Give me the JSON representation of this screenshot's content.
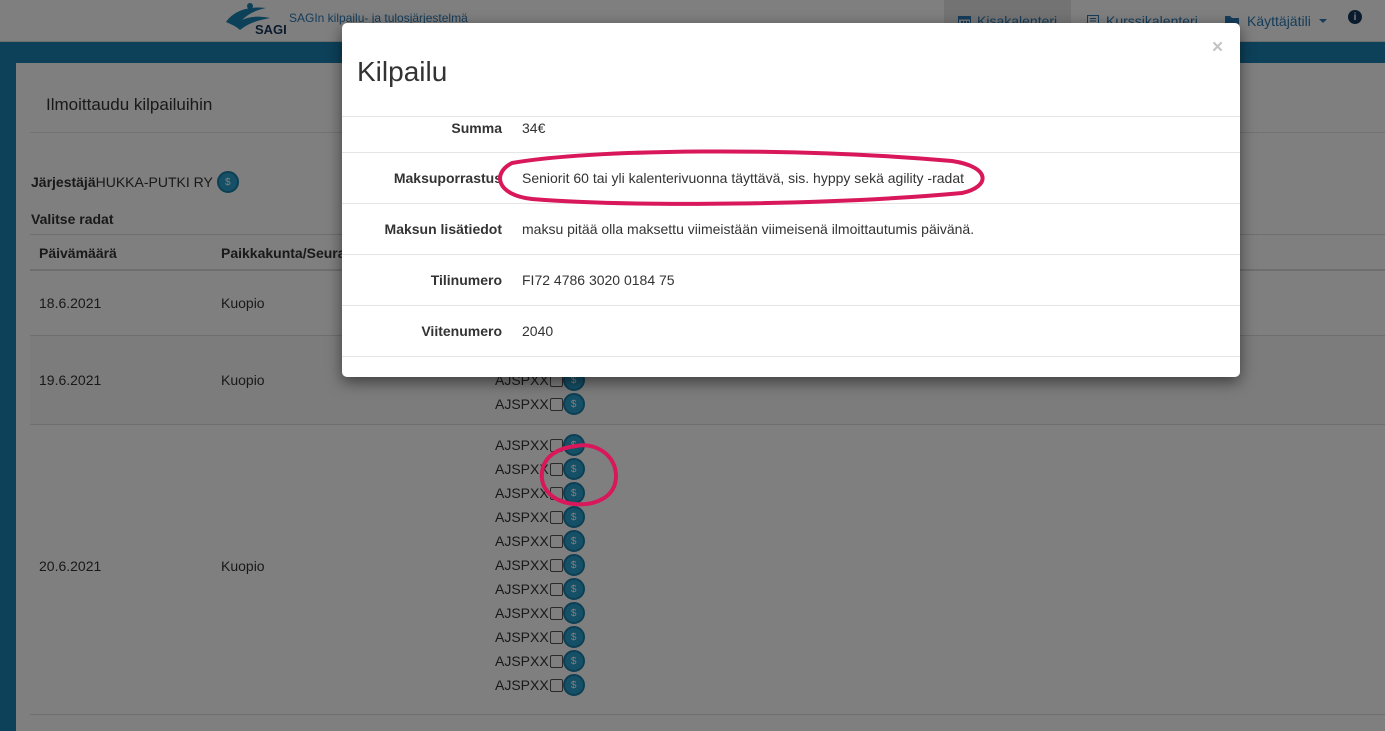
{
  "navbar": {
    "logo_text": "SAGI",
    "brand": "SAGIn kilpailu- ja tulosjärjestelmä",
    "items": [
      {
        "label": "Kisakalenteri",
        "icon": "calendar-icon",
        "active": true
      },
      {
        "label": "Kurssikalenteri",
        "icon": "list-icon",
        "active": false
      },
      {
        "label": "Käyttäjätili",
        "icon": "folder-icon",
        "active": false
      }
    ],
    "info_icon": "i"
  },
  "page": {
    "title": "Ilmoittaudu kilpailuihin",
    "organizer_label": "Järjestäjä",
    "organizer_name": "HUKKA-PUTKI RY",
    "select_heading": "Valitse radat",
    "columns": [
      "Päivämäärä",
      "Paikkakunta/Seura"
    ],
    "rows": [
      {
        "date": "18.6.2021",
        "place": "Kuopio",
        "classes": []
      },
      {
        "date": "19.6.2021",
        "place": "Kuopio",
        "classes": [
          "AJSPXX",
          "AJSPXX"
        ]
      },
      {
        "date": "20.6.2021",
        "place": "Kuopio",
        "classes": [
          "AJSPXX",
          "AJSPXX",
          "AJSPXX",
          "AJSPXX",
          "AJSPXX",
          "AJSPXX",
          "AJSPXX",
          "AJSPXX",
          "AJSPXX",
          "AJSPXX",
          "AJSPXX"
        ]
      }
    ],
    "coin_glyph": "$"
  },
  "modal": {
    "title": "Kilpailu",
    "close": "×",
    "fields": [
      {
        "key": "Summa",
        "value": "34€"
      },
      {
        "key": "Maksuporrastus",
        "value": "Seniorit 60 tai yli kalenterivuonna täyttävä, sis. hyppy sekä agility -radat"
      },
      {
        "key": "Maksun lisätiedot",
        "value": "maksu pitää olla maksettu viimeistään viimeisenä ilmoittautumis päivänä."
      },
      {
        "key": "Tilinumero",
        "value": "FI72 4786 3020 0184 75"
      },
      {
        "key": "Viitenumero",
        "value": "2040"
      }
    ]
  },
  "colors": {
    "brand_blue": "#1a82b4",
    "link_blue": "#2a79b4",
    "coin": "#2aa0cc",
    "annotation": "#d8185a"
  }
}
